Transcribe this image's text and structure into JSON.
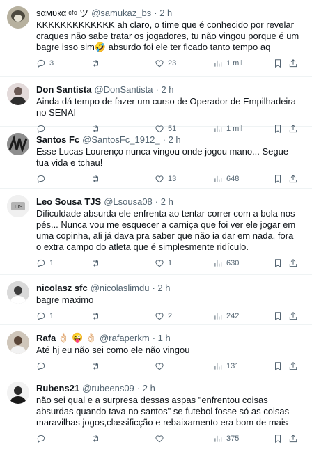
{
  "tweets": [
    {
      "name": "ѕαмυкα",
      "name_extra": "ᶜᶠᶜ ツ",
      "handle": "@samukaz_bs",
      "time": "· 2 h",
      "text": "KKKKKKKKKKKKK ah claro, o time que é conhecido por revelar craques não sabe tratar os jogadores, tu não vingou porque é um bagre isso sim🤣 absurdo foi ele ter ficado tanto tempo aq",
      "replies": "3",
      "retweets": "",
      "likes": "23",
      "views": "1 mil"
    },
    {
      "name": "Don Santista",
      "name_extra": "",
      "handle": "@DonSantista",
      "time": "· 2 h",
      "text": "Ainda dá tempo de fazer um curso de Operador de Empilhadeira no SENAI",
      "replies": "",
      "retweets": "",
      "likes": "51",
      "views": "1 mil"
    },
    {
      "name": "Santos Fc",
      "name_extra": "",
      "handle": "@SantosFc_1912_",
      "time": "· 2 h",
      "text": "Esse Lucas Lourenço nunca vingou onde jogou mano... Segue tua vida e tchau!",
      "replies": "",
      "retweets": "",
      "likes": "13",
      "views": "648"
    },
    {
      "name": "Leo Sousa TJS",
      "name_extra": "",
      "handle": "@Lsousa08",
      "time": "· 2 h",
      "text": "Dificuldade absurda ele enfrenta ao tentar correr com a bola nos pés... Nunca vou me esquecer a carniça que foi ver ele jogar em uma copinha, ali já dava pra saber que não ia dar em nada, fora o extra campo  do atleta que é simplesmente ridículo.",
      "replies": "1",
      "retweets": "",
      "likes": "1",
      "views": "630"
    },
    {
      "name": "nicolasz sfc",
      "name_extra": "",
      "handle": "@nicolaslimdu",
      "time": "· 2 h",
      "text": "bagre maximo",
      "replies": "1",
      "retweets": "",
      "likes": "2",
      "views": "242"
    },
    {
      "name": "Rafa",
      "name_extra": "👌🏻 😜 👌🏻",
      "handle": "@rafaperkm",
      "time": "· 1 h",
      "text": "Até hj eu não sei como ele não vingou",
      "replies": "",
      "retweets": "",
      "likes": "",
      "views": "131"
    },
    {
      "name": "Rubens21",
      "name_extra": "",
      "handle": "@rubeens09",
      "time": "· 2 h",
      "text": "não sei qual e a surpresa dessas aspas \"enfrentou coisas absurdas quando tava no santos\" se futebol fosse só as coisas maravilhas jogos,classificção e rebaixamento era bom de mais",
      "replies": "",
      "retweets": "",
      "likes": "",
      "views": "375"
    }
  ],
  "colors": {
    "text": "#0f1419",
    "secondary": "#536471",
    "divider": "#eff3f4"
  },
  "icons": [
    "reply-icon",
    "retweet-icon",
    "like-icon",
    "views-icon",
    "bookmark-icon",
    "share-icon"
  ]
}
